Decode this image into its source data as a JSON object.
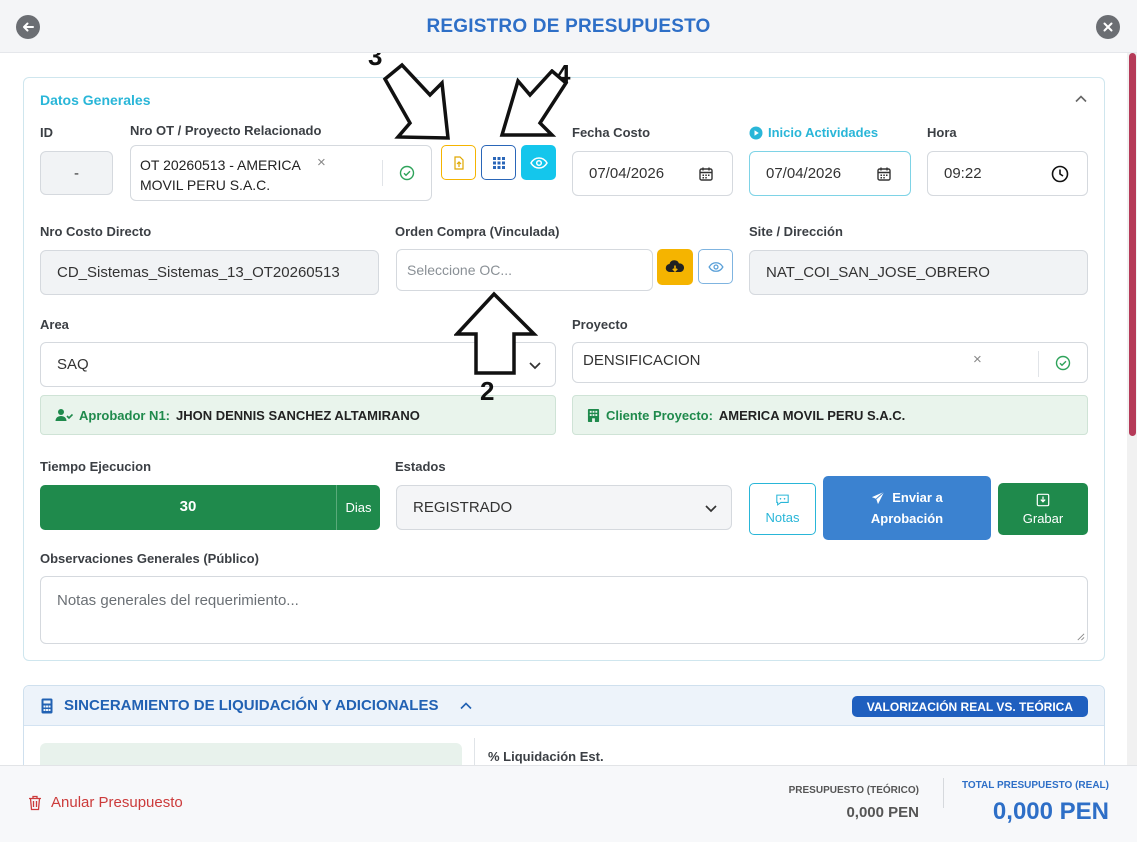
{
  "header": {
    "title": "REGISTRO DE PRESUPUESTO"
  },
  "datos_generales": {
    "title": "Datos Generales",
    "id_label": "ID",
    "id_value": "-",
    "ot_label": "Nro OT / Proyecto Relacionado",
    "ot_value": "OT 20260513 - AMERICA MOVIL PERU S.A.C.",
    "fecha_costo_label": "Fecha Costo",
    "fecha_costo_value": "07/04/2026",
    "inicio_label": "Inicio Actividades",
    "inicio_value": "07/04/2026",
    "hora_label": "Hora",
    "hora_value": "09:22",
    "costo_directo_label": "Nro Costo Directo",
    "costo_directo_value": "CD_Sistemas_Sistemas_13_OT20260513",
    "orden_compra_label": "Orden Compra (Vinculada)",
    "orden_compra_placeholder": "Seleccione OC...",
    "site_label": "Site / Dirección",
    "site_value": "NAT_COI_SAN_JOSE_OBRERO",
    "area_label": "Area",
    "area_value": "SAQ",
    "proyecto_label": "Proyecto",
    "proyecto_value": "DENSIFICACION",
    "aprobador_key": "Aprobador N1:",
    "aprobador_value": "JHON DENNIS SANCHEZ ALTAMIRANO",
    "cliente_key": "Cliente Proyecto:",
    "cliente_value": "AMERICA MOVIL PERU S.A.C.",
    "tiempo_label": "Tiempo Ejecucion",
    "tiempo_value": "30",
    "tiempo_unit": "Dias",
    "estados_label": "Estados",
    "estados_value": "REGISTRADO",
    "notas_label": "Notas",
    "enviar_label_1": "Enviar a",
    "enviar_label_2": "Aprobación",
    "grabar_label": "Grabar",
    "observaciones_label": "Observaciones Generales (Público)",
    "observaciones_placeholder": "Notas generales del requerimiento..."
  },
  "annotations": {
    "a2": "2",
    "a3": "3",
    "a4": "4"
  },
  "liquidacion": {
    "title": "SINCERAMIENTO DE LIQUIDACIÓN Y ADICIONALES",
    "badge": "VALORIZACIÓN REAL VS. TEÓRICA",
    "pct_label": "% Liquidación Est."
  },
  "footer": {
    "anular_label": "Anular Presupuesto",
    "teorico_label": "PRESUPUESTO (TEÓRICO)",
    "teorico_value": "0,000 PEN",
    "total_label": "TOTAL PRESUPUESTO (REAL)",
    "total_value": "0,000 PEN"
  },
  "colors": {
    "title_blue": "#2e6fc7",
    "cyan": "#29b6d8",
    "green": "#1f8a4c",
    "primary_blue": "#3b82d0",
    "amber": "#f5b400",
    "red": "#cc3b3b"
  },
  "icons": [
    "back-arrow-icon",
    "close-icon",
    "chevron-up-icon",
    "check-circle-icon",
    "file-upload-icon",
    "grid-icon",
    "eye-icon",
    "calendar-icon",
    "clock-icon",
    "cloud-download-icon",
    "chevron-down-icon",
    "user-check-icon",
    "building-icon",
    "comment-icon",
    "send-icon",
    "save-icon",
    "calculator-icon",
    "trash-icon",
    "play-circle-icon"
  ]
}
